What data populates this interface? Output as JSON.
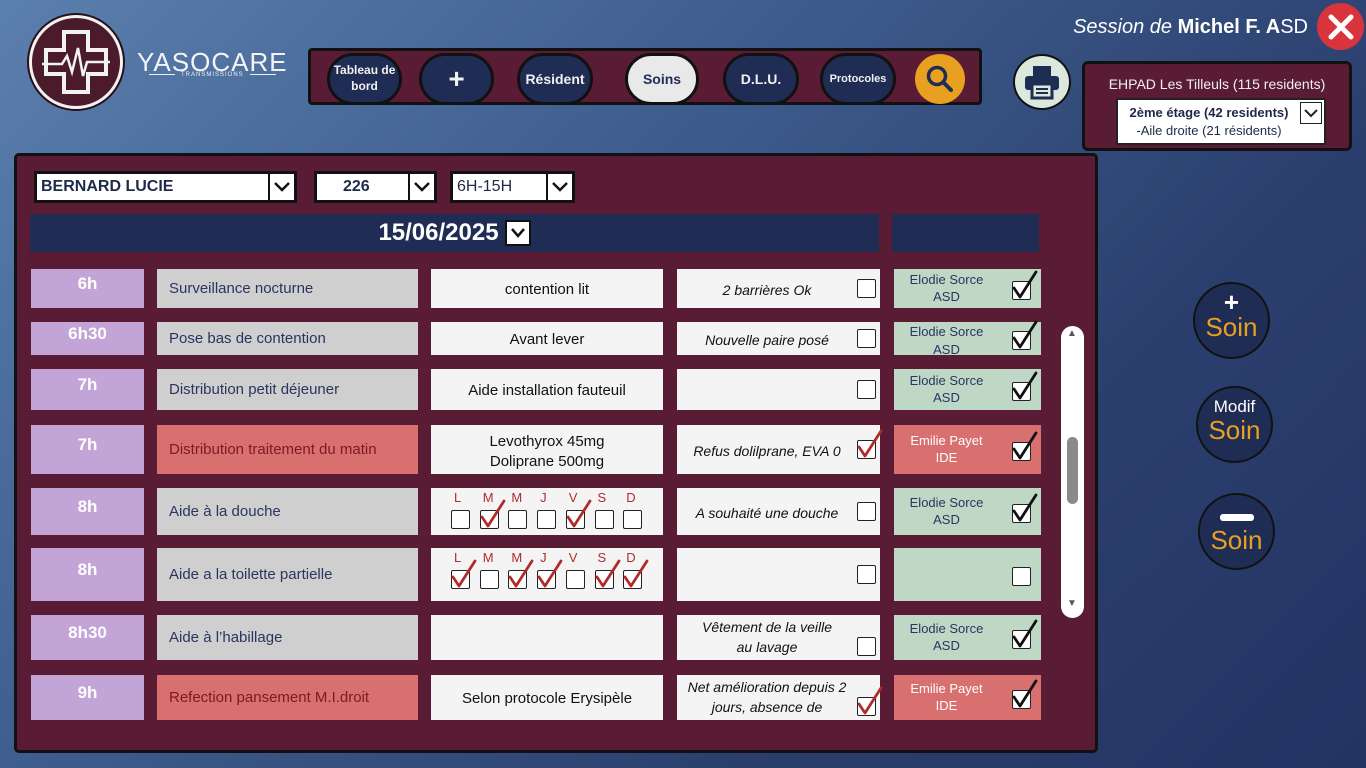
{
  "app": {
    "name": "YASOCARE",
    "sub": "TRANSMISSIONS"
  },
  "session": {
    "prefix": "Session de",
    "user": "Michel F. A",
    "role": "SD"
  },
  "nav": [
    {
      "id": "dashboard",
      "label": "Tableau de bord"
    },
    {
      "id": "add",
      "label": "+"
    },
    {
      "id": "resident",
      "label": "Résident"
    },
    {
      "id": "soins",
      "label": "Soins",
      "active": true
    },
    {
      "id": "dlu",
      "label": "D.L.U."
    },
    {
      "id": "protocoles",
      "label": "Protocoles"
    }
  ],
  "facility": {
    "title": "EHPAD Les Tilleuls (115 residents)",
    "floor": "2ème étage (42 residents)",
    "wing": "-Aile droite (21 résidents)"
  },
  "filters": {
    "resident": "BERNARD LUCIE",
    "room": "226",
    "shift": "6H-15H"
  },
  "date": "15/06/2025",
  "days": [
    "L",
    "M",
    "M",
    "J",
    "V",
    "S",
    "D"
  ],
  "rows": [
    {
      "time": "6h",
      "task": "Surveillance nocturne",
      "detail": "contention lit",
      "obs": "2 barrières Ok",
      "obs_checked": false,
      "sign_name": "Elodie Sorce",
      "sign_role": "ASD",
      "sign_checked": true,
      "red": false
    },
    {
      "time": "6h30",
      "task": "Pose bas de contention",
      "detail": "Avant lever",
      "obs": "Nouvelle paire posé",
      "obs_checked": false,
      "sign_name": "Elodie Sorce",
      "sign_role": "ASD",
      "sign_checked": true,
      "red": false
    },
    {
      "time": "7h",
      "task": "Distribution petit déjeuner",
      "detail": "Aide installation fauteuil",
      "obs": "",
      "obs_checked": false,
      "sign_name": "Elodie Sorce",
      "sign_role": "ASD",
      "sign_checked": true,
      "red": false
    },
    {
      "time": "7h",
      "task": "Distribution traitement du matin",
      "detail": "Levothyrox 45mg",
      "detail2": "Doliprane 500mg",
      "obs": "Refus dolilprane, EVA 0",
      "obs_checked": true,
      "sign_name": "Emilie Payet",
      "sign_role": "IDE",
      "sign_checked": true,
      "red": true
    },
    {
      "time": "8h",
      "task": "Aide à la douche",
      "days_checked": [
        false,
        true,
        false,
        false,
        true,
        false,
        false
      ],
      "obs": "A souhaité une douche",
      "obs_checked": false,
      "sign_name": "Elodie Sorce",
      "sign_role": "ASD",
      "sign_checked": true,
      "red": false
    },
    {
      "time": "8h",
      "task": "Aide a la toilette partielle",
      "days_checked": [
        true,
        false,
        true,
        true,
        false,
        true,
        true
      ],
      "obs": "",
      "obs_checked": false,
      "sign_name": "",
      "sign_role": "",
      "sign_checked": false,
      "red": false
    },
    {
      "time": "8h30",
      "task": "Aide à l’habillage",
      "detail": "",
      "obs": "Vêtement de la veille",
      "obs2": "au lavage",
      "obs_checked": false,
      "sign_name": "Elodie Sorce",
      "sign_role": "ASD",
      "sign_checked": true,
      "red": false
    },
    {
      "time": "9h",
      "task": "Refection pansement M.I.droit",
      "detail": "Selon protocole Erysipèle",
      "obs": "Net amélioration depuis 2",
      "obs2": "jours, absence de",
      "obs_checked": true,
      "sign_name": "Emilie Payet",
      "sign_role": "IDE",
      "sign_checked": true,
      "red": true
    }
  ],
  "actions": {
    "add_symbol": "+",
    "add_label": "Soin",
    "modify_top": "Modif",
    "modify_label": "Soin",
    "remove_label": "Soin"
  },
  "colors": {
    "accent": "#e8a020",
    "panel": "#5a1c34",
    "navy": "#1f2d55",
    "check": "#b22b2b"
  }
}
